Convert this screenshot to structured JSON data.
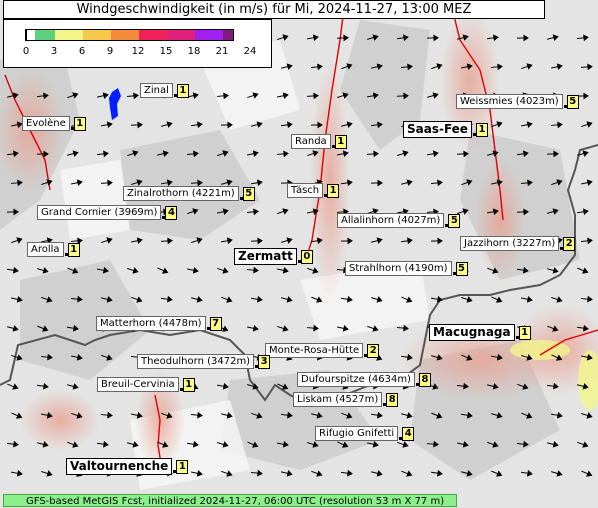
{
  "title": "Windgeschwindigkeit (in m/s) für Mi, 2024-11-27, 13:00 MEZ",
  "legend": {
    "ticks": [
      "0",
      "3",
      "6",
      "9",
      "12",
      "15",
      "18",
      "21",
      "24"
    ],
    "colors": [
      "#ffffff",
      "#5ed27a",
      "#f3f58a",
      "#f5c84a",
      "#f58c3a",
      "#f0205a",
      "#e0207a",
      "#a020f0",
      "#801a80"
    ]
  },
  "places": [
    {
      "name": "Zinal",
      "value": "1",
      "big": false
    },
    {
      "name": "Evolène",
      "value": "1",
      "big": false
    },
    {
      "name": "Weissmies (4023m)",
      "value": "5",
      "big": false
    },
    {
      "name": "Saas-Fee",
      "value": "1",
      "big": true
    },
    {
      "name": "Randa",
      "value": "1",
      "big": false
    },
    {
      "name": "Täsch",
      "value": "1",
      "big": false
    },
    {
      "name": "Zinalrothorn (4221m)",
      "value": "5",
      "big": false
    },
    {
      "name": "Grand Cornier (3969m)",
      "value": "4",
      "big": false
    },
    {
      "name": "Allalinhorn (4027m)",
      "value": "5",
      "big": false
    },
    {
      "name": "Arolla",
      "value": "1",
      "big": false
    },
    {
      "name": "Jazzihorn (3227m)",
      "value": "2",
      "big": false
    },
    {
      "name": "Zermatt",
      "value": "0",
      "big": true
    },
    {
      "name": "Strahlhorn (4190m)",
      "value": "5",
      "big": false
    },
    {
      "name": "Matterhorn (4478m)",
      "value": "7",
      "big": false
    },
    {
      "name": "Macugnaga",
      "value": "1",
      "big": true
    },
    {
      "name": "Monte-Rosa-Hütte",
      "value": "2",
      "big": false
    },
    {
      "name": "Theodulhorn (3472m)",
      "value": "3",
      "big": false
    },
    {
      "name": "Breuil-Cervinia",
      "value": "1",
      "big": false
    },
    {
      "name": "Dufourspitze (4634m)",
      "value": "8",
      "big": false
    },
    {
      "name": "Liskam (4527m)",
      "value": "8",
      "big": false
    },
    {
      "name": "Rifugio Gnifetti",
      "value": "4",
      "big": false
    },
    {
      "name": "Valtournenche",
      "value": "1",
      "big": true
    }
  ],
  "footer": "GFS-based MetGIS Fcst, initialized 2024-11-27, 06:00 UTC  (resolution 53 m X 77 m)"
}
